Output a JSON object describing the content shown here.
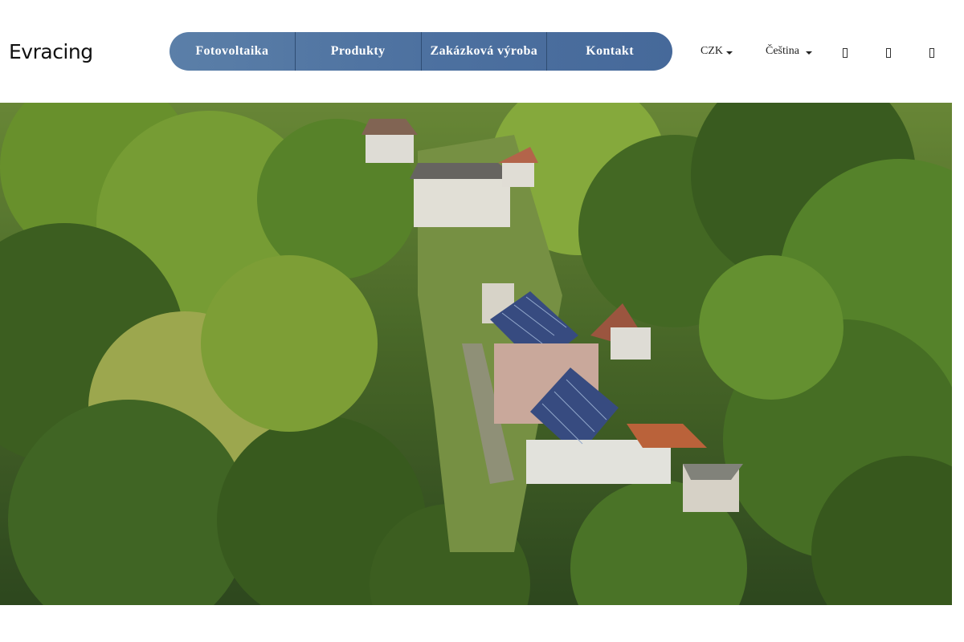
{
  "brand": {
    "logo_text": "Evracing",
    "logo_name": "Evracing"
  },
  "nav": {
    "items": [
      {
        "label": "Fotovoltaika"
      },
      {
        "label": "Produkty"
      },
      {
        "label": "Zakázková výroba"
      },
      {
        "label": "Kontakt"
      }
    ],
    "color": "#4d71a0"
  },
  "currency": {
    "selected": "CZK"
  },
  "language": {
    "selected": "Čeština"
  },
  "header_icons": [
    "user-icon",
    "wishlist-icon",
    "cart-icon"
  ],
  "hero": {
    "image_subject": "aerial-houses-solar-forest"
  }
}
